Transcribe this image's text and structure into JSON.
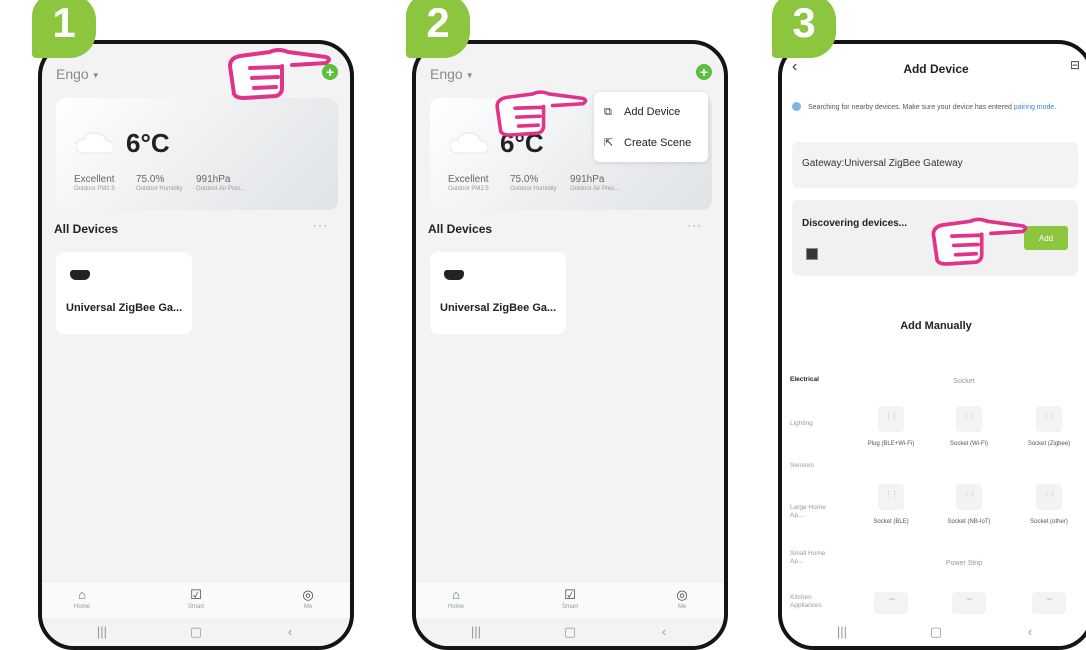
{
  "steps": [
    "1",
    "2",
    "3"
  ],
  "home": {
    "brand": "Engo",
    "temperature": "6°C",
    "stats": [
      {
        "value": "Excellent",
        "label": "Outdoor PM2.5"
      },
      {
        "value": "75.0%",
        "label": "Outdoor Humidity"
      },
      {
        "value": "991hPa",
        "label": "Outdoor Air Pres..."
      }
    ],
    "section_title": "All Devices",
    "more_label": "···",
    "device_name": "Universal ZigBee Ga...",
    "nav": [
      {
        "icon": "home-icon",
        "label": "Home"
      },
      {
        "icon": "smart-icon",
        "label": "Smart"
      },
      {
        "icon": "me-icon",
        "label": "Me"
      }
    ]
  },
  "menu": {
    "items": [
      {
        "icon": "add-device-icon",
        "label": "Add Device"
      },
      {
        "icon": "create-scene-icon",
        "label": "Create Scene"
      }
    ]
  },
  "add_device": {
    "title": "Add Device",
    "info_prefix": "Searching for nearby devices. Make sure your device has entered ",
    "info_link": "pairing mode",
    "info_suffix": ".",
    "gateway": "Gateway:Universal ZigBee Gateway",
    "discovering": "Discovering devices...",
    "add_label": "Add",
    "add_manually": "Add Manually",
    "categories": [
      "Electrical",
      "Lighting",
      "Sensors",
      "Large Home Ap...",
      "Small Home Ap...",
      "Kitchen Appliances"
    ],
    "group_socket": "Socket",
    "group_power_strip": "Power Strip",
    "tiles_row1": [
      "Plug (BLE+Wi-Fi)",
      "Socket (Wi-Fi)",
      "Socket (Zigbee)"
    ],
    "tiles_row2": [
      "Socket (BLE)",
      "Socket (NB-IoT)",
      "Socket (other)"
    ]
  },
  "colors": {
    "accent": "#8cc63e",
    "hand": "#e0338a",
    "link": "#3a86d6"
  }
}
